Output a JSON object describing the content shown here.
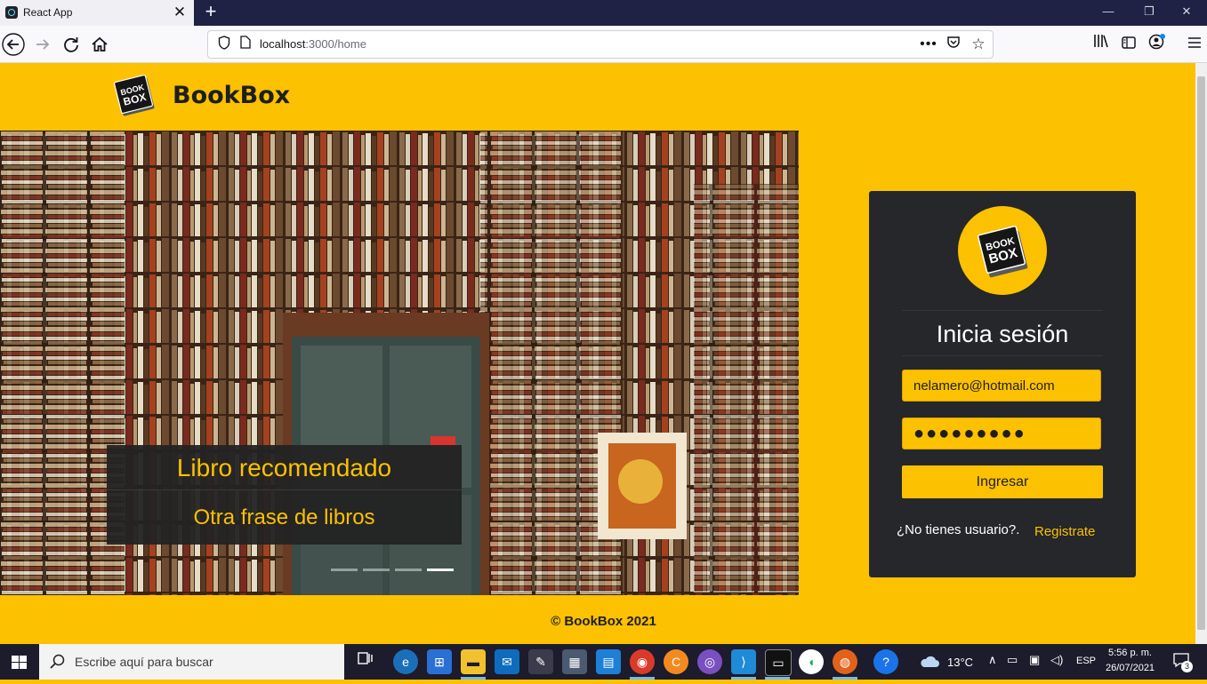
{
  "browser": {
    "tab_title": "React App",
    "tab_close": "✕",
    "new_tab": "+",
    "url_host": "localhost",
    "url_rest": ":3000/home",
    "window_controls": [
      "—",
      "❐",
      "✕"
    ],
    "icons": [
      "back-icon",
      "forward-icon",
      "reload-icon",
      "home-icon",
      "shield-icon",
      "page-icon",
      "more-icon",
      "pocket-icon",
      "bookmark-star-icon",
      "library-icon",
      "sidebar-icon",
      "account-icon",
      "menu-icon"
    ]
  },
  "header": {
    "logo_top": "BOOK",
    "logo_bottom": "BOX",
    "brand": "BookBox"
  },
  "carousel": {
    "caption_title": "Libro recomendado",
    "caption_text": "Otra frase de libros",
    "slides": 4,
    "active_slide": 4
  },
  "login": {
    "logo_top": "BOOK",
    "logo_bottom": "BOX",
    "title": "Inicia sesión",
    "email_value": "nelamero@hotmail.com",
    "password_value": "●●●●●●●●●",
    "submit_label": "Ingresar",
    "no_user_text": "¿No tienes usuario?.",
    "register_label": "Registrate"
  },
  "footer": {
    "text": "© BookBox 2021"
  },
  "taskbar": {
    "search_placeholder": "Escribe aquí para buscar",
    "weather": "13°C",
    "language": "ESP",
    "time": "5:56 p. m.",
    "date": "26/07/2021",
    "notifications": "3"
  },
  "colors": {
    "accent": "#fcc101",
    "card": "#25272b",
    "dark_text": "#1e1e1e"
  }
}
